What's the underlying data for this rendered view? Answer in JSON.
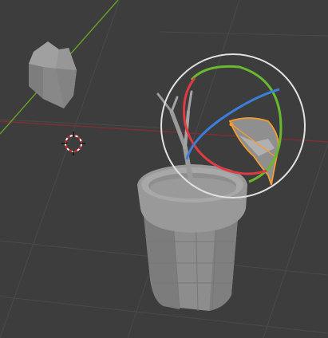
{
  "app": "3D viewport",
  "viewport": {
    "background_color": "#3d3d3d",
    "grid_color": "#4a4a4a",
    "axis_x_color": "#7f2f34",
    "axis_y_color": "#6aa128",
    "mesh_color": "#8f8f8f",
    "selection_outline_color": "#f39c32",
    "gizmo": {
      "type": "rotate",
      "x_axis_color": "#e03a44",
      "y_axis_color": "#6ab82e",
      "z_axis_color": "#3b7ed8",
      "view_ring_color": "#e0e0e0"
    }
  }
}
